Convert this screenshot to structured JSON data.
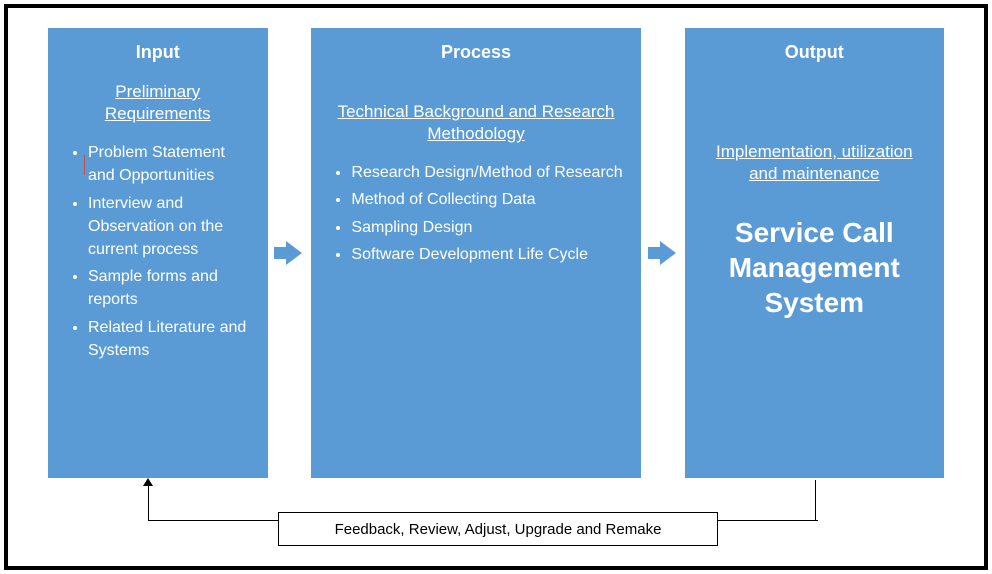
{
  "input": {
    "title": "Input",
    "subtitle": "Preliminary Requirements",
    "items": [
      "Problem Statement and Opportunities",
      "Interview and Observation on the current process",
      "Sample forms and reports",
      "Related Literature and Systems"
    ]
  },
  "process": {
    "title": "Process",
    "subtitle": "Technical Background and Research Methodology",
    "items": [
      "Research Design/Method of Research",
      "Method of Collecting Data",
      "Sampling Design",
      "Software Development Life Cycle"
    ]
  },
  "output": {
    "title": "Output",
    "subtitle": "Implementation, utilization and maintenance",
    "system": "Service Call Management System"
  },
  "feedback": "Feedback, Review, Adjust, Upgrade and Remake"
}
